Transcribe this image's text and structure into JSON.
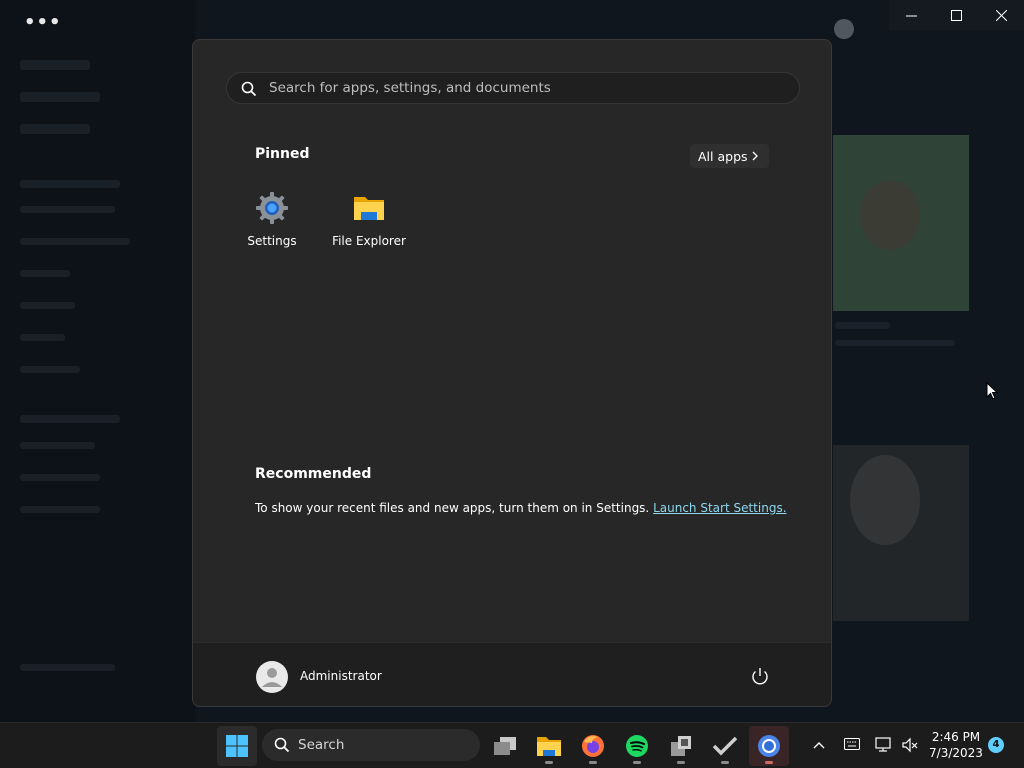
{
  "background_app": {
    "menu_dots": "•••"
  },
  "start_menu": {
    "search": {
      "placeholder": "Search for apps, settings, and documents"
    },
    "pinned": {
      "title": "Pinned",
      "all_apps_label": "All apps",
      "items": [
        {
          "label": "Settings",
          "icon": "gear-icon"
        },
        {
          "label": "File Explorer",
          "icon": "folder-icon"
        }
      ]
    },
    "recommended": {
      "title": "Recommended",
      "text": "To show your recent files and new apps, turn them on in Settings.",
      "link": "Launch Start Settings."
    },
    "user": {
      "name": "Administrator"
    }
  },
  "taskbar": {
    "search_label": "Search",
    "apps": [
      "start-icon",
      "task-view-icon",
      "file-explorer-icon",
      "firefox-icon",
      "spotify-icon",
      "app-icon",
      "checkmark-icon",
      "chrome-icon"
    ],
    "clock": {
      "time": "2:46 PM",
      "date": "7/3/2023"
    },
    "notification_count": "4"
  },
  "colors": {
    "accent": "#60cdff",
    "link": "#8fd8ee",
    "start_bg": "#272727",
    "taskbar_bg": "#1c1c1c"
  }
}
